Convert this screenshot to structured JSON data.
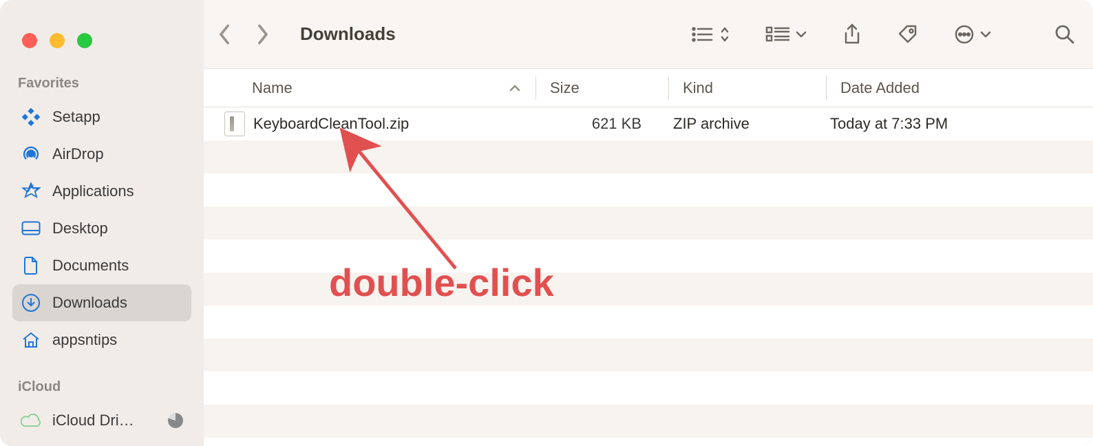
{
  "window": {
    "title": "Downloads"
  },
  "sidebar": {
    "sections": [
      {
        "title": "Favorites",
        "items": [
          {
            "icon": "setapp",
            "label": "Setapp",
            "selected": false
          },
          {
            "icon": "airdrop",
            "label": "AirDrop",
            "selected": false
          },
          {
            "icon": "applications",
            "label": "Applications",
            "selected": false
          },
          {
            "icon": "desktop",
            "label": "Desktop",
            "selected": false
          },
          {
            "icon": "documents",
            "label": "Documents",
            "selected": false
          },
          {
            "icon": "downloads",
            "label": "Downloads",
            "selected": true
          },
          {
            "icon": "home",
            "label": "appsntips",
            "selected": false
          }
        ]
      },
      {
        "title": "iCloud",
        "items": [
          {
            "icon": "cloud",
            "label": "iCloud Dri…",
            "selected": false,
            "badge": "pie"
          }
        ]
      }
    ]
  },
  "columns": {
    "name": "Name",
    "size": "Size",
    "kind": "Kind",
    "date": "Date Added"
  },
  "rows": [
    {
      "name": "KeyboardCleanTool.zip",
      "size": "621 KB",
      "kind": "ZIP archive",
      "date": "Today at 7:33 PM"
    }
  ],
  "annotation": {
    "text": "double-click"
  },
  "colors": {
    "accent": "#1e75d8",
    "annotation": "#e15050"
  }
}
